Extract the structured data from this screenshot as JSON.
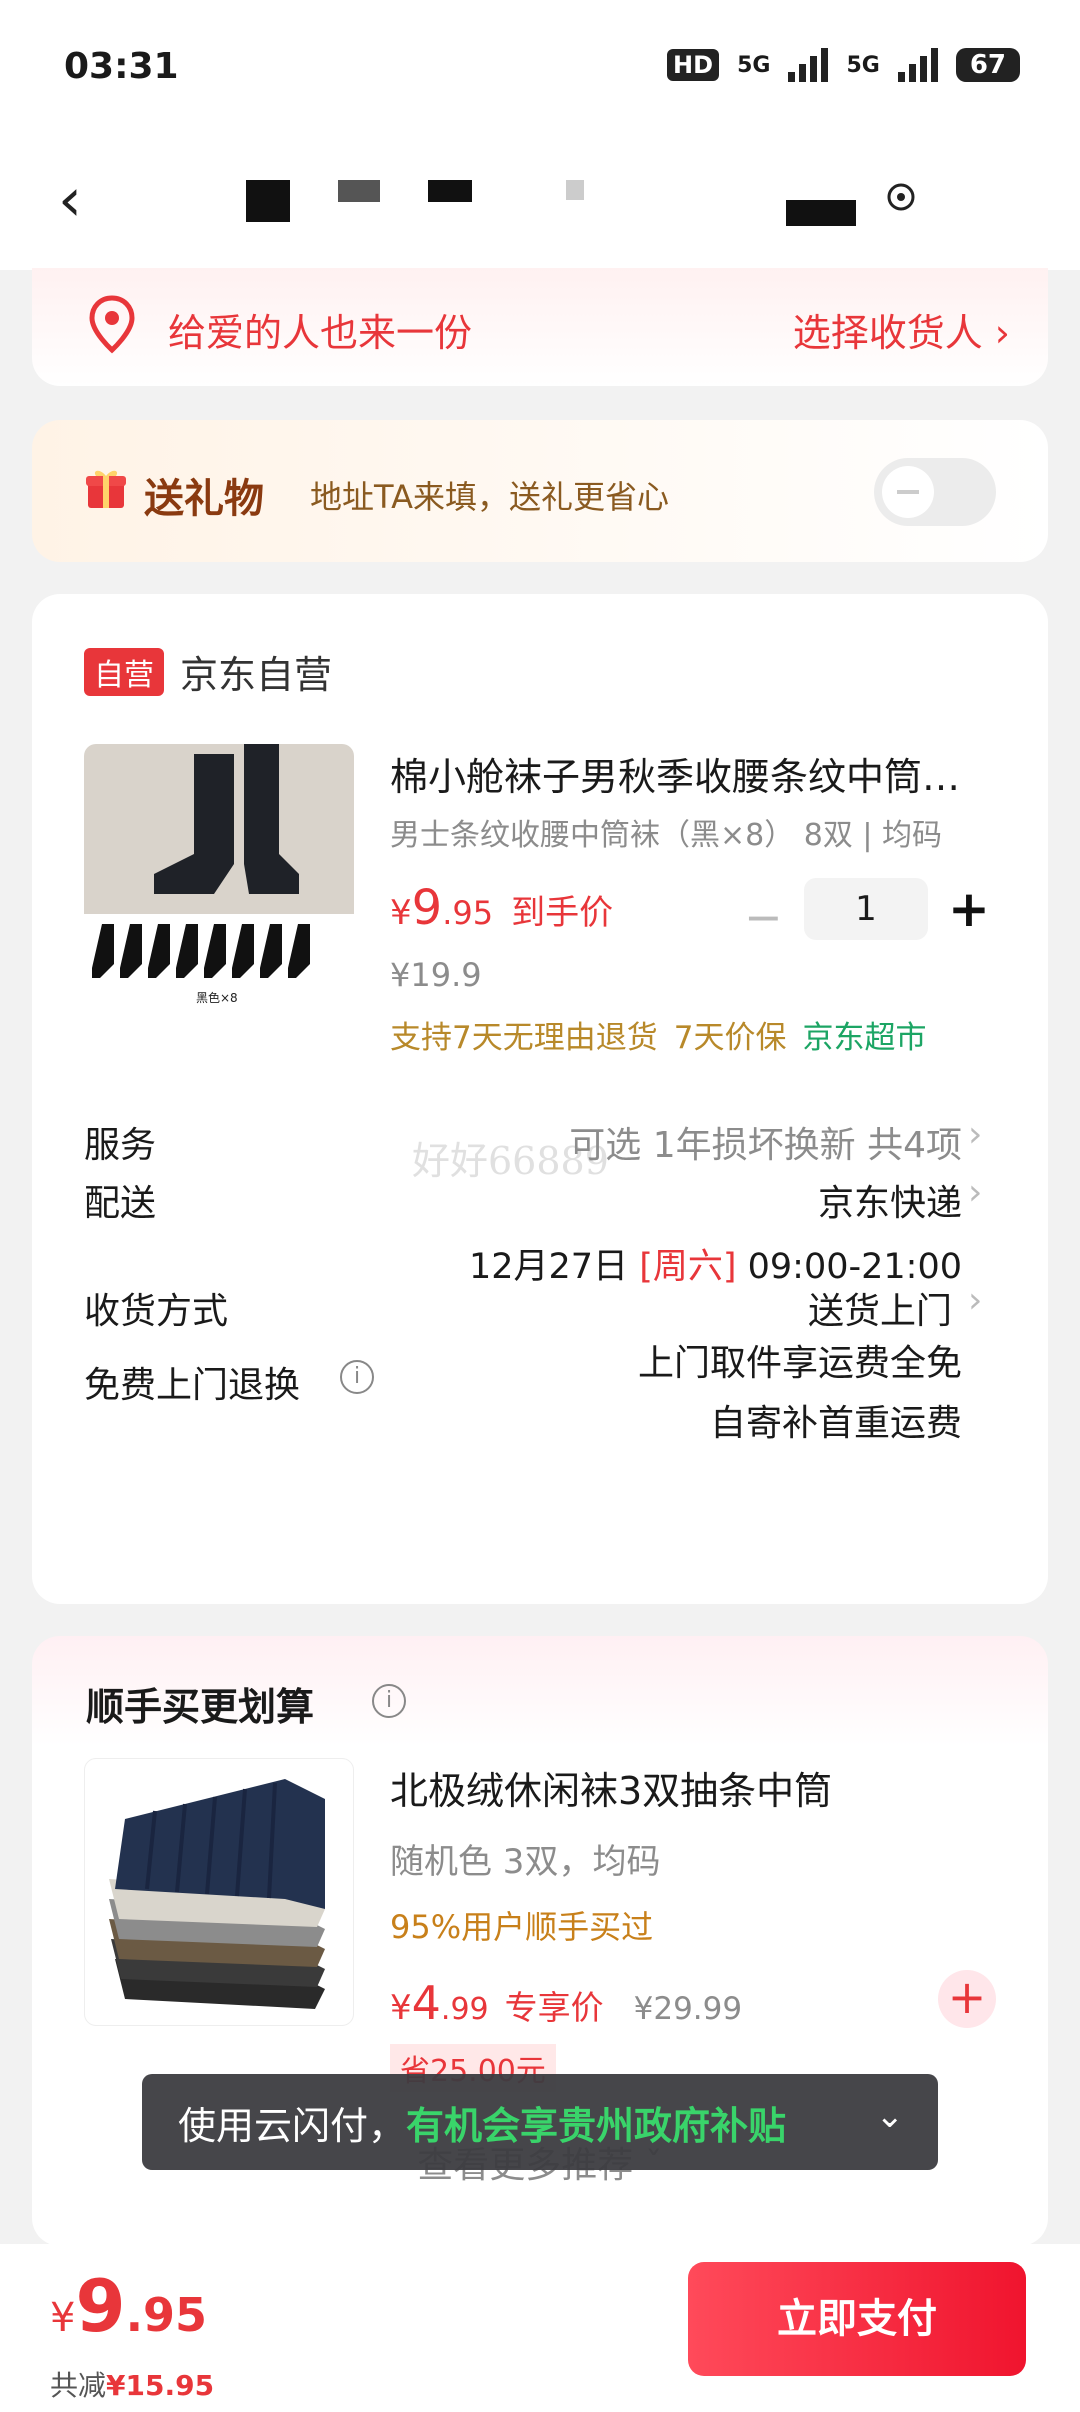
{
  "status_bar": {
    "time": "03:31",
    "hd": "HD",
    "net1": "5G",
    "net2": "5G",
    "battery": "67"
  },
  "nav": {
    "title": "",
    "icons": [
      "chevron-left-icon",
      "location-icon"
    ]
  },
  "gift_banner": {
    "text": "给爱的人也来一份",
    "action": "选择收货人 ›"
  },
  "gift_toggle": {
    "title": "送礼物",
    "subtitle": "地址TA来填，送礼更省心",
    "enabled": false
  },
  "order": {
    "badge": "自营",
    "shop": "京东自营",
    "product": {
      "title": "棉小舱袜子男秋季收腰条纹中筒…",
      "spec": "男士条纹收腰中筒袜（黑×8）  8双 | 均码",
      "price_yen": "¥",
      "price_int": "9",
      "price_dec": ".95",
      "price_tag": "到手价",
      "quantity": "1",
      "orig_price": "¥19.9",
      "promise1": "支持7天无理由退货",
      "promise2": "7天价保",
      "promise3": "京东超市",
      "image_caption": "黑色×8"
    },
    "rows": {
      "service_label": "服务",
      "service_value": "可选 1年损坏换新 共4项",
      "delivery_label": "配送",
      "delivery_value": "京东快递",
      "delivery_date": "12月27日",
      "delivery_weekday": "[周六]",
      "delivery_time": "09:00-21:00",
      "receive_label": "收货方式",
      "receive_value": "送货上门",
      "return_label": "免费上门退换",
      "return_value1": "上门取件享运费全免",
      "return_value2": "自寄补首重运费"
    },
    "watermark": "好好66889"
  },
  "recommend": {
    "title": "顺手买更划算",
    "name": "北极绒休闲袜3双抽条中筒",
    "spec": "随机色 3双，均码",
    "bought": "95%用户顺手买过",
    "price_yen": "¥",
    "price_int": "4",
    "price_dec": ".99",
    "price_tag": "专享价",
    "orig_price": "¥29.99",
    "save": "省25.00元",
    "more": "查看更多推荐 ˇ"
  },
  "toast": {
    "prefix": "使用云闪付，",
    "highlight": "有机会享贵州政府补贴"
  },
  "bottom": {
    "yen": "¥",
    "int": "9",
    "dec": ".95",
    "saved_label": "共减",
    "saved_value": "¥15.95",
    "pay_label": "立即支付"
  },
  "colors": {
    "brand_red": "#e8363a",
    "promise_gold": "#b8892a",
    "jd_green": "#1ca564"
  }
}
